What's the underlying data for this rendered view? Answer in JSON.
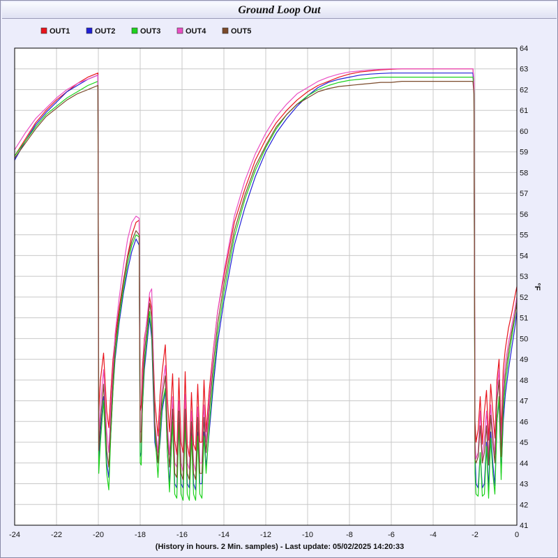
{
  "window": {
    "title": "Ground Loop Out"
  },
  "chart_data": {
    "type": "line",
    "title": "Ground Loop Out",
    "xlabel": "(History in hours. 2 Min. samples) - Last update: 05/02/2025 14:20:33",
    "ylabel": "°F",
    "xlim": [
      -24,
      0
    ],
    "ylim": [
      41,
      64
    ],
    "x_ticks": [
      -24,
      -22,
      -20,
      -18,
      -16,
      -14,
      -12,
      -10,
      -8,
      -6,
      -4,
      -2,
      0
    ],
    "y_ticks": [
      41,
      42,
      43,
      44,
      45,
      46,
      47,
      48,
      49,
      50,
      51,
      52,
      53,
      54,
      55,
      56,
      57,
      58,
      59,
      60,
      61,
      62,
      63,
      64
    ],
    "grid": true,
    "legend_position": "top-left",
    "series": [
      {
        "name": "OUT1",
        "color": "#e8141c",
        "x": [
          -24,
          -23.5,
          -23,
          -22.5,
          -22,
          -21.5,
          -21,
          -20.5,
          -20.02,
          -19.98,
          -19.9,
          -19.75,
          -19.6,
          -19.5,
          -19.4,
          -19.3,
          -19.2,
          -19,
          -18.8,
          -18.6,
          -18.4,
          -18.2,
          -18.05,
          -18.0,
          -17.95,
          -17.9,
          -17.8,
          -17.65,
          -17.55,
          -17.45,
          -17.3,
          -17.15,
          -17.05,
          -16.95,
          -16.8,
          -16.7,
          -16.6,
          -16.45,
          -16.35,
          -16.25,
          -16.15,
          -16.05,
          -15.95,
          -15.85,
          -15.75,
          -15.65,
          -15.55,
          -15.45,
          -15.35,
          -15.25,
          -15.15,
          -15.05,
          -14.95,
          -14.85,
          -14.7,
          -14.5,
          -14.3,
          -14,
          -13.5,
          -13,
          -12.5,
          -12,
          -11.5,
          -11,
          -10.5,
          -10,
          -9.5,
          -9,
          -8.5,
          -8,
          -7.5,
          -7,
          -6.5,
          -6,
          -5.5,
          -5,
          -4.5,
          -4,
          -3.5,
          -3,
          -2.5,
          -2.2,
          -2.1,
          -2.05,
          -2.0,
          -1.95,
          -1.85,
          -1.75,
          -1.65,
          -1.55,
          -1.45,
          -1.35,
          -1.25,
          -1.15,
          -1.05,
          -0.95,
          -0.85,
          -0.75,
          -0.65,
          -0.55,
          -0.4,
          -0.25,
          -0.1,
          0
        ],
        "y": [
          58.8,
          59.6,
          60.4,
          61.0,
          61.5,
          61.9,
          62.3,
          62.6,
          62.8,
          46.5,
          48.0,
          49.3,
          46.5,
          45.7,
          47.5,
          49.0,
          50.0,
          51.5,
          52.8,
          54.0,
          55.0,
          55.6,
          55.7,
          46.5,
          46.8,
          48.5,
          50.0,
          51.0,
          52.0,
          51.4,
          47.0,
          45.3,
          47.3,
          48.4,
          49.7,
          47.1,
          45.5,
          48.3,
          45.1,
          44.4,
          48.1,
          45.0,
          44.5,
          48.4,
          44.9,
          44.3,
          47.4,
          44.9,
          44.6,
          47.8,
          45.0,
          45.0,
          48.0,
          45.5,
          47.5,
          49.5,
          51.3,
          53.0,
          55.6,
          57.2,
          58.6,
          59.6,
          60.4,
          61.0,
          61.5,
          61.9,
          62.2,
          62.4,
          62.6,
          62.75,
          62.85,
          62.9,
          62.95,
          62.98,
          63.0,
          63.0,
          63.0,
          63.0,
          63.0,
          63.0,
          63.0,
          63.0,
          63.0,
          62.3,
          46.0,
          45.0,
          45.6,
          47.2,
          44.9,
          46.5,
          47.5,
          45.1,
          47.8,
          46.5,
          45.2,
          48.0,
          49.0,
          45.5,
          48.5,
          49.5,
          50.5,
          51.2,
          52.0,
          52.5
        ]
      },
      {
        "name": "OUT2",
        "color": "#1f1fd6",
        "x": [
          -24,
          -23.5,
          -23,
          -22.5,
          -22,
          -21.5,
          -21,
          -20.5,
          -20.02,
          -19.98,
          -19.9,
          -19.75,
          -19.6,
          -19.5,
          -19.4,
          -19.3,
          -19.2,
          -19,
          -18.8,
          -18.6,
          -18.4,
          -18.2,
          -18.05,
          -18.0,
          -17.95,
          -17.9,
          -17.8,
          -17.65,
          -17.55,
          -17.45,
          -17.3,
          -17.15,
          -17.05,
          -16.95,
          -16.8,
          -16.7,
          -16.6,
          -16.45,
          -16.35,
          -16.25,
          -16.15,
          -16.05,
          -15.95,
          -15.85,
          -15.75,
          -15.65,
          -15.55,
          -15.45,
          -15.35,
          -15.25,
          -15.15,
          -15.05,
          -14.95,
          -14.85,
          -14.7,
          -14.5,
          -14.3,
          -14,
          -13.5,
          -13,
          -12.5,
          -12,
          -11.5,
          -11,
          -10.5,
          -10,
          -9.5,
          -9,
          -8.5,
          -8,
          -7.5,
          -7,
          -6.5,
          -6,
          -5.5,
          -5,
          -4.5,
          -4,
          -3.5,
          -3,
          -2.5,
          -2.2,
          -2.1,
          -2.05,
          -2.0,
          -1.95,
          -1.85,
          -1.75,
          -1.65,
          -1.55,
          -1.45,
          -1.35,
          -1.25,
          -1.15,
          -1.05,
          -0.95,
          -0.85,
          -0.75,
          -0.65,
          -0.55,
          -0.4,
          -0.25,
          -0.1,
          0
        ],
        "y": [
          58.6,
          59.5,
          60.3,
          60.9,
          61.4,
          61.9,
          62.2,
          62.5,
          62.7,
          44.0,
          45.5,
          47.2,
          44.0,
          43.3,
          45.5,
          47.5,
          49.0,
          50.8,
          52.2,
          53.3,
          54.2,
          54.8,
          54.5,
          44.3,
          44.5,
          46.5,
          48.5,
          50.0,
          51.0,
          50.0,
          45.0,
          44.0,
          45.0,
          46.5,
          47.5,
          44.5,
          43.0,
          46.0,
          43.0,
          42.8,
          46.0,
          43.0,
          42.8,
          46.0,
          43.0,
          42.8,
          45.5,
          43.0,
          42.7,
          45.5,
          43.0,
          43.0,
          45.5,
          43.8,
          45.5,
          47.8,
          49.8,
          51.8,
          54.5,
          56.3,
          57.8,
          59.0,
          59.9,
          60.6,
          61.2,
          61.7,
          62.1,
          62.35,
          62.5,
          62.6,
          62.7,
          62.75,
          62.78,
          62.8,
          62.8,
          62.8,
          62.8,
          62.8,
          62.8,
          62.8,
          62.8,
          62.8,
          62.8,
          62.0,
          44.5,
          43.0,
          42.8,
          44.5,
          42.8,
          43.0,
          45.0,
          42.8,
          45.5,
          44.0,
          42.9,
          46.0,
          47.0,
          43.5,
          46.0,
          47.3,
          48.5,
          49.5,
          50.5,
          51.3
        ]
      },
      {
        "name": "OUT3",
        "color": "#1ed21e",
        "x": [
          -24,
          -23.5,
          -23,
          -22.5,
          -22,
          -21.5,
          -21,
          -20.5,
          -20.02,
          -19.98,
          -19.9,
          -19.75,
          -19.6,
          -19.5,
          -19.4,
          -19.3,
          -19.2,
          -19,
          -18.8,
          -18.6,
          -18.4,
          -18.2,
          -18.05,
          -18.0,
          -17.95,
          -17.9,
          -17.8,
          -17.65,
          -17.55,
          -17.45,
          -17.3,
          -17.15,
          -17.05,
          -16.95,
          -16.8,
          -16.7,
          -16.6,
          -16.45,
          -16.35,
          -16.25,
          -16.15,
          -16.05,
          -15.95,
          -15.85,
          -15.75,
          -15.65,
          -15.55,
          -15.45,
          -15.35,
          -15.25,
          -15.15,
          -15.05,
          -14.95,
          -14.85,
          -14.7,
          -14.5,
          -14.3,
          -14,
          -13.5,
          -13,
          -12.5,
          -12,
          -11.5,
          -11,
          -10.5,
          -10,
          -9.5,
          -9,
          -8.5,
          -8,
          -7.5,
          -7,
          -6.5,
          -6,
          -5.5,
          -5,
          -4.5,
          -4,
          -3.5,
          -3,
          -2.5,
          -2.2,
          -2.1,
          -2.05,
          -2.0,
          -1.95,
          -1.85,
          -1.75,
          -1.65,
          -1.55,
          -1.45,
          -1.35,
          -1.25,
          -1.15,
          -1.05,
          -0.95,
          -0.85,
          -0.75,
          -0.65,
          -0.55,
          -0.4,
          -0.25,
          -0.1,
          0
        ],
        "y": [
          58.8,
          59.5,
          60.2,
          60.8,
          61.2,
          61.6,
          61.9,
          62.2,
          62.4,
          43.5,
          45.0,
          47.0,
          43.5,
          42.7,
          45.5,
          47.5,
          49.2,
          51.0,
          52.4,
          53.6,
          54.5,
          55.0,
          54.9,
          44.0,
          43.9,
          46.5,
          48.8,
          50.3,
          51.3,
          50.3,
          45.5,
          43.3,
          45.3,
          46.8,
          47.6,
          44.5,
          42.6,
          46.0,
          42.5,
          42.3,
          46.0,
          42.5,
          42.2,
          46.0,
          42.5,
          42.2,
          45.3,
          42.5,
          42.2,
          45.3,
          42.5,
          42.3,
          45.3,
          43.5,
          45.8,
          48.2,
          50.2,
          52.2,
          54.9,
          56.7,
          58.1,
          59.2,
          60.1,
          60.8,
          61.3,
          61.7,
          62.0,
          62.2,
          62.35,
          62.45,
          62.5,
          62.55,
          62.6,
          62.6,
          62.6,
          62.6,
          62.6,
          62.6,
          62.6,
          62.6,
          62.6,
          62.6,
          62.6,
          62.0,
          43.5,
          42.5,
          42.4,
          44.5,
          42.4,
          42.5,
          44.8,
          42.3,
          45.2,
          43.5,
          42.5,
          46.0,
          47.2,
          43.2,
          46.5,
          47.8,
          49.0,
          50.0,
          51.0,
          51.8
        ]
      },
      {
        "name": "OUT4",
        "color": "#ea4fc4",
        "x": [
          -24,
          -23.5,
          -23,
          -22.5,
          -22,
          -21.5,
          -21,
          -20.5,
          -20.02,
          -19.98,
          -19.9,
          -19.75,
          -19.6,
          -19.5,
          -19.4,
          -19.3,
          -19.2,
          -19,
          -18.8,
          -18.6,
          -18.4,
          -18.2,
          -18.05,
          -18.0,
          -17.95,
          -17.9,
          -17.8,
          -17.65,
          -17.55,
          -17.45,
          -17.3,
          -17.15,
          -17.05,
          -16.95,
          -16.8,
          -16.7,
          -16.6,
          -16.45,
          -16.35,
          -16.25,
          -16.15,
          -16.05,
          -15.95,
          -15.85,
          -15.75,
          -15.65,
          -15.55,
          -15.45,
          -15.35,
          -15.25,
          -15.15,
          -15.05,
          -14.95,
          -14.85,
          -14.7,
          -14.5,
          -14.3,
          -14,
          -13.5,
          -13,
          -12.5,
          -12,
          -11.5,
          -11,
          -10.5,
          -10,
          -9.5,
          -9,
          -8.5,
          -8,
          -7.5,
          -7,
          -6.5,
          -6,
          -5.5,
          -5,
          -4.5,
          -4,
          -3.5,
          -3,
          -2.5,
          -2.2,
          -2.1,
          -2.05,
          -2.0,
          -1.95,
          -1.85,
          -1.75,
          -1.65,
          -1.55,
          -1.45,
          -1.35,
          -1.25,
          -1.15,
          -1.05,
          -0.95,
          -0.85,
          -0.75,
          -0.65,
          -0.55,
          -0.4,
          -0.25,
          -0.1,
          0
        ],
        "y": [
          59.1,
          59.9,
          60.6,
          61.1,
          61.6,
          62.0,
          62.3,
          62.5,
          62.7,
          45.3,
          46.8,
          48.5,
          45.5,
          44.5,
          46.8,
          48.5,
          50.2,
          52.0,
          53.5,
          54.8,
          55.6,
          55.9,
          55.8,
          45.5,
          45.5,
          47.8,
          49.8,
          51.2,
          52.2,
          52.4,
          46.0,
          44.5,
          46.5,
          47.6,
          48.7,
          45.8,
          44.4,
          47.2,
          44.0,
          43.8,
          47.0,
          44.0,
          43.6,
          47.3,
          44.0,
          43.7,
          46.5,
          44.0,
          43.6,
          46.7,
          44.0,
          44.0,
          46.8,
          45.0,
          47.0,
          49.4,
          51.3,
          53.2,
          55.9,
          57.6,
          58.9,
          59.9,
          60.7,
          61.3,
          61.8,
          62.1,
          62.4,
          62.6,
          62.75,
          62.85,
          62.9,
          62.95,
          62.98,
          63.0,
          63.0,
          63.0,
          63.0,
          63.0,
          63.0,
          63.0,
          63.0,
          63.0,
          63.0,
          62.5,
          45.0,
          44.2,
          44.5,
          46.5,
          44.2,
          45.2,
          46.5,
          44.3,
          46.8,
          45.5,
          44.4,
          47.5,
          48.5,
          44.8,
          47.8,
          48.8,
          49.8,
          50.6,
          51.4,
          52.0
        ]
      },
      {
        "name": "OUT5",
        "color": "#7a4a2a",
        "x": [
          -24,
          -23.5,
          -23,
          -22.5,
          -22,
          -21.5,
          -21,
          -20.5,
          -20.02,
          -19.98,
          -19.9,
          -19.75,
          -19.6,
          -19.5,
          -19.4,
          -19.3,
          -19.2,
          -19,
          -18.8,
          -18.6,
          -18.4,
          -18.2,
          -18.05,
          -18.0,
          -17.95,
          -17.9,
          -17.8,
          -17.65,
          -17.55,
          -17.45,
          -17.3,
          -17.15,
          -17.05,
          -16.95,
          -16.8,
          -16.7,
          -16.6,
          -16.45,
          -16.35,
          -16.25,
          -16.15,
          -16.05,
          -15.95,
          -15.85,
          -15.75,
          -15.65,
          -15.55,
          -15.45,
          -15.35,
          -15.25,
          -15.15,
          -15.05,
          -14.95,
          -14.85,
          -14.7,
          -14.5,
          -14.3,
          -14,
          -13.5,
          -13,
          -12.5,
          -12,
          -11.5,
          -11,
          -10.5,
          -10,
          -9.5,
          -9,
          -8.5,
          -8,
          -7.5,
          -7,
          -6.5,
          -6,
          -5.5,
          -5,
          -4.5,
          -4,
          -3.5,
          -3,
          -2.5,
          -2.2,
          -2.1,
          -2.05,
          -2.0,
          -1.95,
          -1.85,
          -1.75,
          -1.65,
          -1.55,
          -1.45,
          -1.35,
          -1.25,
          -1.15,
          -1.05,
          -0.95,
          -0.85,
          -0.75,
          -0.65,
          -0.55,
          -0.4,
          -0.25,
          -0.1,
          0
        ],
        "y": [
          58.7,
          59.4,
          60.1,
          60.7,
          61.1,
          61.5,
          61.8,
          62.0,
          62.2,
          44.6,
          46.0,
          47.8,
          44.6,
          43.8,
          46.0,
          48.0,
          49.6,
          51.3,
          52.7,
          53.9,
          54.7,
          55.2,
          55.0,
          45.0,
          45.0,
          47.2,
          49.3,
          50.7,
          51.7,
          51.0,
          45.8,
          44.0,
          46.0,
          47.2,
          48.2,
          45.3,
          43.8,
          46.6,
          43.5,
          43.3,
          46.5,
          43.5,
          43.2,
          46.6,
          43.5,
          43.2,
          46.0,
          43.5,
          43.2,
          46.2,
          43.5,
          43.5,
          46.2,
          44.5,
          46.5,
          48.8,
          50.7,
          52.6,
          55.2,
          56.9,
          58.3,
          59.3,
          60.2,
          60.8,
          61.3,
          61.6,
          61.9,
          62.05,
          62.15,
          62.2,
          62.25,
          62.3,
          62.35,
          62.35,
          62.4,
          62.4,
          62.4,
          62.4,
          62.4,
          62.4,
          62.4,
          62.4,
          62.4,
          61.8,
          44.2,
          44.0,
          44.3,
          45.8,
          44.0,
          44.5,
          45.8,
          43.9,
          46.3,
          45.0,
          44.0,
          47.0,
          48.0,
          44.3,
          47.2,
          48.3,
          49.4,
          50.3,
          51.1,
          51.7
        ]
      }
    ]
  }
}
